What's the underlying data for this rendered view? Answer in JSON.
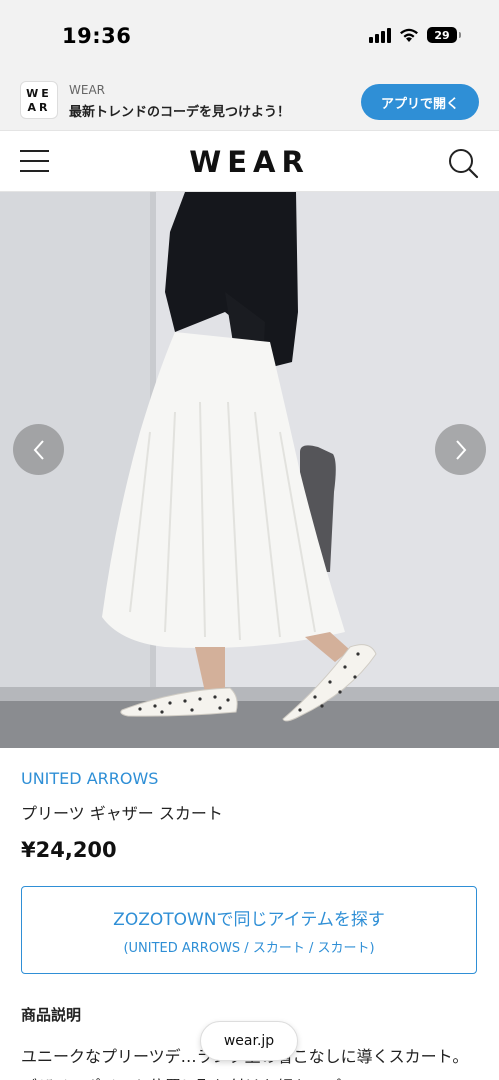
{
  "status_bar": {
    "time": "19:36",
    "battery": "29"
  },
  "app_banner": {
    "logo_text": "WEAR",
    "title": "WEAR",
    "subtitle": "最新トレンドのコーデを見つけよう！",
    "open_button": "アプリで開く"
  },
  "header": {
    "logo": "WEAR"
  },
  "product": {
    "brand": "UNITED ARROWS",
    "name": "プリーツ ギャザー スカート",
    "price": "¥24,200",
    "zozo_button": {
      "line1": "ZOZOTOWNで同じアイテムを探す",
      "line2": "(UNITED ARROWS / スカート / スカート)"
    },
    "description_heading": "商品説明",
    "description_text": "ユニークなプリーツデ…ランク上の着こなしに導くスカート。デザインポイント位置に取り付けた細かいプリーツ"
  },
  "browser": {
    "url": "wear.jp"
  },
  "colors": {
    "accent": "#2f8fd6",
    "banner_bg": "#f2f2f2"
  }
}
